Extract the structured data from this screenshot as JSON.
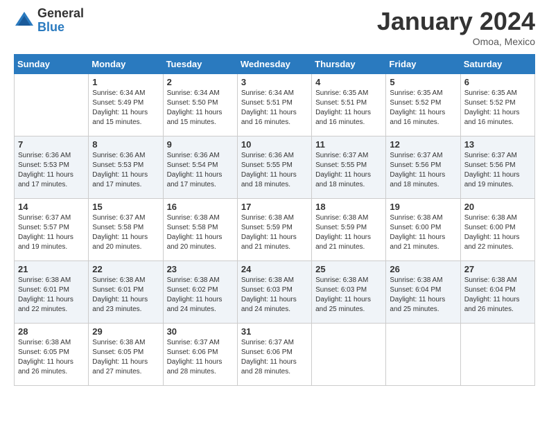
{
  "header": {
    "logo_general": "General",
    "logo_blue": "Blue",
    "month_title": "January 2024",
    "location": "Omoa, Mexico"
  },
  "days_of_week": [
    "Sunday",
    "Monday",
    "Tuesday",
    "Wednesday",
    "Thursday",
    "Friday",
    "Saturday"
  ],
  "weeks": [
    [
      {
        "day": "",
        "sunrise": "",
        "sunset": "",
        "daylight": ""
      },
      {
        "day": "1",
        "sunrise": "6:34 AM",
        "sunset": "5:49 PM",
        "daylight": "11 hours and 15 minutes."
      },
      {
        "day": "2",
        "sunrise": "6:34 AM",
        "sunset": "5:50 PM",
        "daylight": "11 hours and 15 minutes."
      },
      {
        "day": "3",
        "sunrise": "6:34 AM",
        "sunset": "5:51 PM",
        "daylight": "11 hours and 16 minutes."
      },
      {
        "day": "4",
        "sunrise": "6:35 AM",
        "sunset": "5:51 PM",
        "daylight": "11 hours and 16 minutes."
      },
      {
        "day": "5",
        "sunrise": "6:35 AM",
        "sunset": "5:52 PM",
        "daylight": "11 hours and 16 minutes."
      },
      {
        "day": "6",
        "sunrise": "6:35 AM",
        "sunset": "5:52 PM",
        "daylight": "11 hours and 16 minutes."
      }
    ],
    [
      {
        "day": "7",
        "sunrise": "6:36 AM",
        "sunset": "5:53 PM",
        "daylight": "11 hours and 17 minutes."
      },
      {
        "day": "8",
        "sunrise": "6:36 AM",
        "sunset": "5:53 PM",
        "daylight": "11 hours and 17 minutes."
      },
      {
        "day": "9",
        "sunrise": "6:36 AM",
        "sunset": "5:54 PM",
        "daylight": "11 hours and 17 minutes."
      },
      {
        "day": "10",
        "sunrise": "6:36 AM",
        "sunset": "5:55 PM",
        "daylight": "11 hours and 18 minutes."
      },
      {
        "day": "11",
        "sunrise": "6:37 AM",
        "sunset": "5:55 PM",
        "daylight": "11 hours and 18 minutes."
      },
      {
        "day": "12",
        "sunrise": "6:37 AM",
        "sunset": "5:56 PM",
        "daylight": "11 hours and 18 minutes."
      },
      {
        "day": "13",
        "sunrise": "6:37 AM",
        "sunset": "5:56 PM",
        "daylight": "11 hours and 19 minutes."
      }
    ],
    [
      {
        "day": "14",
        "sunrise": "6:37 AM",
        "sunset": "5:57 PM",
        "daylight": "11 hours and 19 minutes."
      },
      {
        "day": "15",
        "sunrise": "6:37 AM",
        "sunset": "5:58 PM",
        "daylight": "11 hours and 20 minutes."
      },
      {
        "day": "16",
        "sunrise": "6:38 AM",
        "sunset": "5:58 PM",
        "daylight": "11 hours and 20 minutes."
      },
      {
        "day": "17",
        "sunrise": "6:38 AM",
        "sunset": "5:59 PM",
        "daylight": "11 hours and 21 minutes."
      },
      {
        "day": "18",
        "sunrise": "6:38 AM",
        "sunset": "5:59 PM",
        "daylight": "11 hours and 21 minutes."
      },
      {
        "day": "19",
        "sunrise": "6:38 AM",
        "sunset": "6:00 PM",
        "daylight": "11 hours and 21 minutes."
      },
      {
        "day": "20",
        "sunrise": "6:38 AM",
        "sunset": "6:00 PM",
        "daylight": "11 hours and 22 minutes."
      }
    ],
    [
      {
        "day": "21",
        "sunrise": "6:38 AM",
        "sunset": "6:01 PM",
        "daylight": "11 hours and 22 minutes."
      },
      {
        "day": "22",
        "sunrise": "6:38 AM",
        "sunset": "6:01 PM",
        "daylight": "11 hours and 23 minutes."
      },
      {
        "day": "23",
        "sunrise": "6:38 AM",
        "sunset": "6:02 PM",
        "daylight": "11 hours and 24 minutes."
      },
      {
        "day": "24",
        "sunrise": "6:38 AM",
        "sunset": "6:03 PM",
        "daylight": "11 hours and 24 minutes."
      },
      {
        "day": "25",
        "sunrise": "6:38 AM",
        "sunset": "6:03 PM",
        "daylight": "11 hours and 25 minutes."
      },
      {
        "day": "26",
        "sunrise": "6:38 AM",
        "sunset": "6:04 PM",
        "daylight": "11 hours and 25 minutes."
      },
      {
        "day": "27",
        "sunrise": "6:38 AM",
        "sunset": "6:04 PM",
        "daylight": "11 hours and 26 minutes."
      }
    ],
    [
      {
        "day": "28",
        "sunrise": "6:38 AM",
        "sunset": "6:05 PM",
        "daylight": "11 hours and 26 minutes."
      },
      {
        "day": "29",
        "sunrise": "6:38 AM",
        "sunset": "6:05 PM",
        "daylight": "11 hours and 27 minutes."
      },
      {
        "day": "30",
        "sunrise": "6:37 AM",
        "sunset": "6:06 PM",
        "daylight": "11 hours and 28 minutes."
      },
      {
        "day": "31",
        "sunrise": "6:37 AM",
        "sunset": "6:06 PM",
        "daylight": "11 hours and 28 minutes."
      },
      {
        "day": "",
        "sunrise": "",
        "sunset": "",
        "daylight": ""
      },
      {
        "day": "",
        "sunrise": "",
        "sunset": "",
        "daylight": ""
      },
      {
        "day": "",
        "sunrise": "",
        "sunset": "",
        "daylight": ""
      }
    ]
  ],
  "labels": {
    "sunrise_prefix": "Sunrise: ",
    "sunset_prefix": "Sunset: ",
    "daylight_prefix": "Daylight: "
  }
}
